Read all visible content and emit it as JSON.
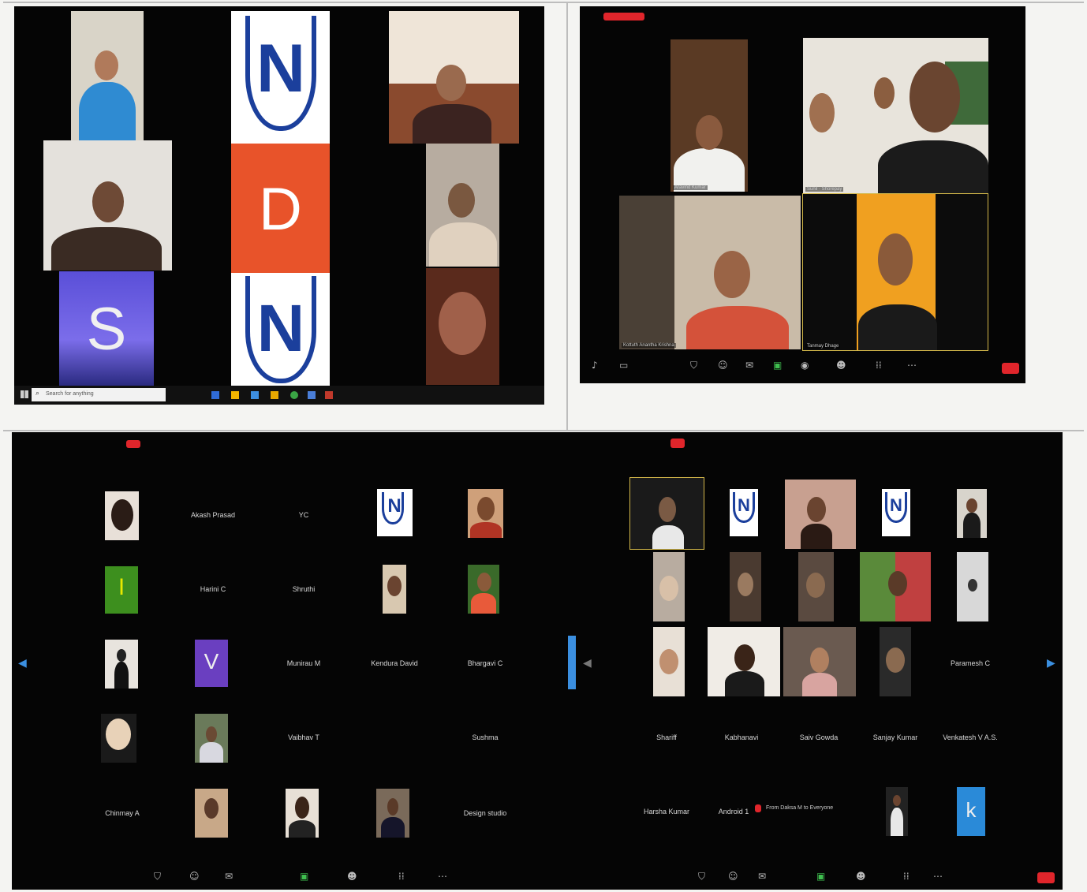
{
  "q1": {
    "taskbar": {
      "search_placeholder": "Search for anything"
    },
    "tile_letters": {
      "d": "D",
      "s": "S",
      "n": "N"
    }
  },
  "q2": {
    "labels": [
      "Aravind Kumar",
      "Sunil · Shorepay",
      "Kottuth Anantha Krishna",
      "Tanmay Dhage"
    ]
  },
  "q3": {
    "names": {
      "akash": "Akash Prasad",
      "yc": "YC",
      "harini": "Harini C",
      "shruthi": "Shruthi",
      "munirau": "Munirau M",
      "kendura": "Kendura David",
      "bhargavi": "Bhargavi C",
      "sushma": "Sushma",
      "chinmay": "Chinmay A",
      "design": "Design studio",
      "sub1": "Vaibhav T"
    },
    "letters": {
      "i": "I",
      "v": "V"
    }
  },
  "q4": {
    "names": {
      "paramesh": "Paramesh C",
      "shariff": "Shariff",
      "kabhanavi": "Kabhanavi",
      "saiv": "Saiv Gowda",
      "sanjay": "Sanjay Kumar",
      "venkatesh": "Venkatesh V A.S.",
      "harsha": "Harsha Kumar",
      "android": "Android 1",
      "from": "From Daksa M to Everyone"
    },
    "letters": {
      "k": "k"
    }
  },
  "colors": {
    "logo_blue": "#1b3f9c",
    "orange": "#e8532a",
    "purple": "#6a3fc0",
    "leave_red": "#e0252b",
    "active_yellow": "#d4b84a"
  },
  "icons": [
    "windows-icon",
    "search-icon",
    "mic-icon",
    "video-icon",
    "security-icon",
    "participants-icon",
    "chat-icon",
    "share-icon",
    "record-icon",
    "reactions-icon",
    "apps-icon",
    "more-icon",
    "chevron-left-icon",
    "chevron-right-icon"
  ]
}
